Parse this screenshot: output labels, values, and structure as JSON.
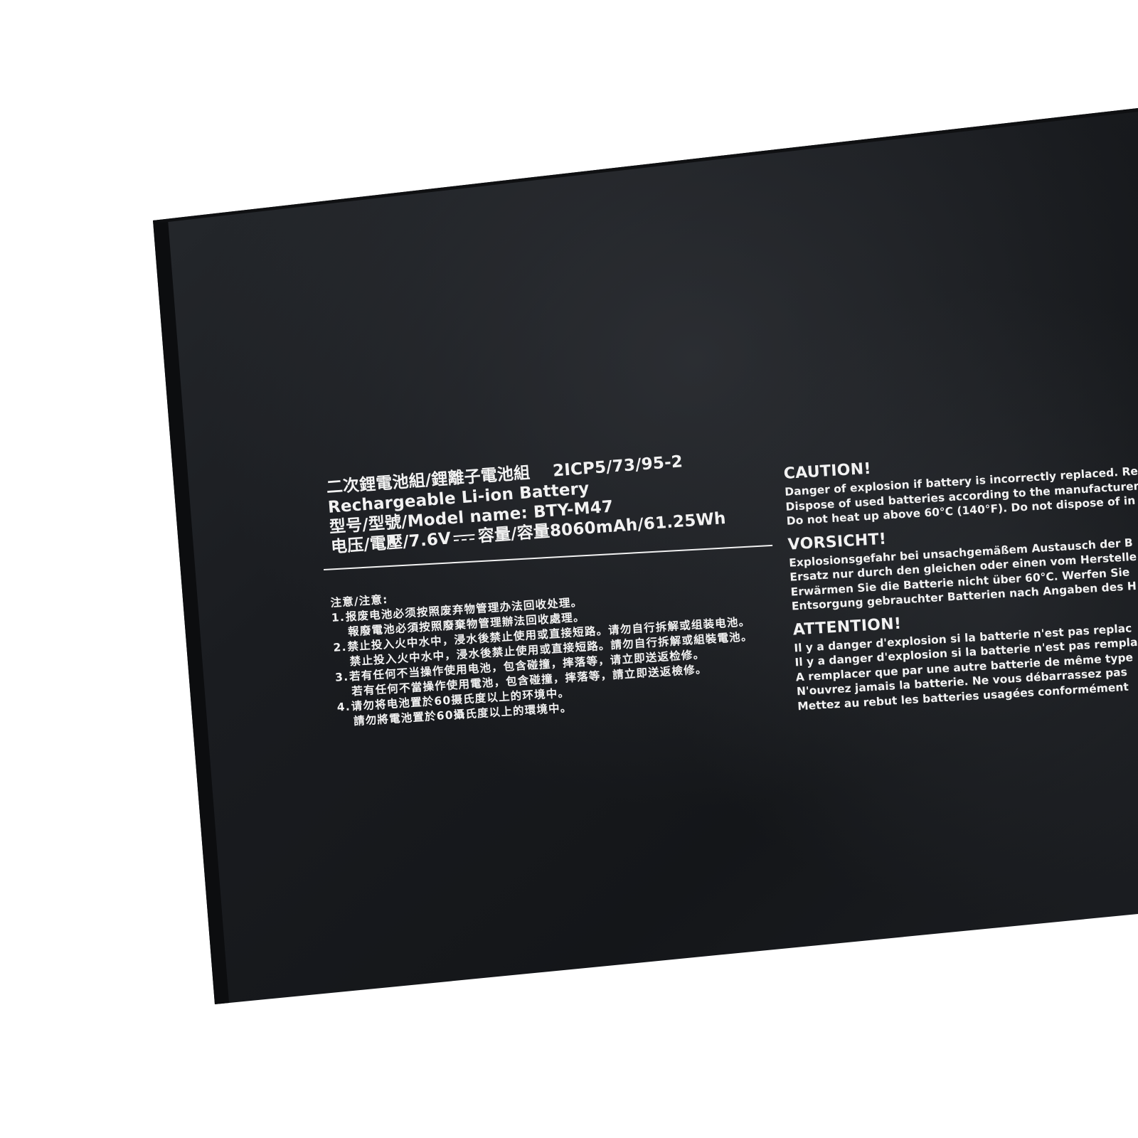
{
  "colors": {
    "background": "#ffffff",
    "battery_body": "#17191c",
    "battery_edge": "#0a0b0c",
    "print": "#f2f2f2"
  },
  "label": {
    "title_cn": "二次鋰電池組/鋰離子電池組",
    "cell_code": "2ICP5/73/95-2",
    "title_en": "Rechargeable Li-ion Battery",
    "model_prefix": "型号/型號/Model name: ",
    "model_name": "BTY-M47",
    "voltage_prefix": "电压/電壓/7.6V",
    "capacity_text": "容量/容量8060mAh/61.25Wh",
    "notes": {
      "heading": "注意/注意:",
      "lines": [
        {
          "num": "1.",
          "text": "报废电池必须按照废弃物管理办法回收处理。"
        },
        {
          "num": "",
          "text": "報廢電池必須按照廢棄物管理辦法回收處理。"
        },
        {
          "num": "2.",
          "text": "禁止投入火中水中，浸水後禁止使用或直接短路。请勿自行拆解或组装电池。"
        },
        {
          "num": "",
          "text": "禁止投入火中水中，浸水後禁止使用或直接短路。請勿自行拆解或組裝電池。"
        },
        {
          "num": "3.",
          "text": "若有任何不当操作使用电池，包含碰撞，摔落等，请立即送返检修。"
        },
        {
          "num": "",
          "text": "若有任何不當操作使用電池，包含碰撞，摔落等，請立即送返檢修。"
        },
        {
          "num": "4.",
          "text": "请勿将电池置於60摄氏度以上的环境中。"
        },
        {
          "num": "",
          "text": "請勿將電池置於60攝氏度以上的環境中。"
        }
      ]
    },
    "warnings": [
      {
        "heading": "CAUTION!",
        "lines": [
          "Danger of explosion if battery is incorrectly replaced. Repl",
          "Dispose of used batteries according to the manufacturer's",
          "Do not heat up above 60°C (140°F). Do not dispose of in"
        ]
      },
      {
        "heading": "VORSICHT!",
        "lines": [
          "Explosionsgefahr bei unsachgemäßem Austausch der B",
          "Ersatz nur durch den gleichen oder einen vom Herstelle",
          "Erwärmen Sie die Batterie nicht über 60°C. Werfen Sie",
          "Entsorgung gebrauchter Batterien nach Angaben des H"
        ]
      },
      {
        "heading": "ATTENTION!",
        "lines": [
          "Il y a danger d'explosion si la batterie n'est pas replac",
          "Il y a danger d'explosion si la batterie n'est pas remplac",
          "A remplacer que par une autre batterie de même type",
          "N'ouvrez jamais la batterie. Ne vous débarrassez pas",
          "Mettez au rebut les batteries usagées conformément"
        ]
      }
    ]
  }
}
